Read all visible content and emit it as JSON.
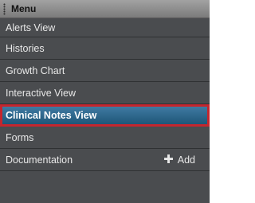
{
  "menu": {
    "title": "Menu",
    "items": [
      {
        "label": "Alerts View"
      },
      {
        "label": "Histories"
      },
      {
        "label": "Growth Chart"
      },
      {
        "label": "Interactive View"
      },
      {
        "label": "Clinical Notes View",
        "selected": true
      },
      {
        "label": "Forms"
      },
      {
        "label": "Documentation",
        "action": {
          "icon": "plus-icon",
          "label": "Add"
        }
      }
    ]
  },
  "colors": {
    "panel_bg": "#4a4c4f",
    "selected_bg": "#2b6a92",
    "selected_border": "#c4262e",
    "text": "#e8e8e8"
  }
}
